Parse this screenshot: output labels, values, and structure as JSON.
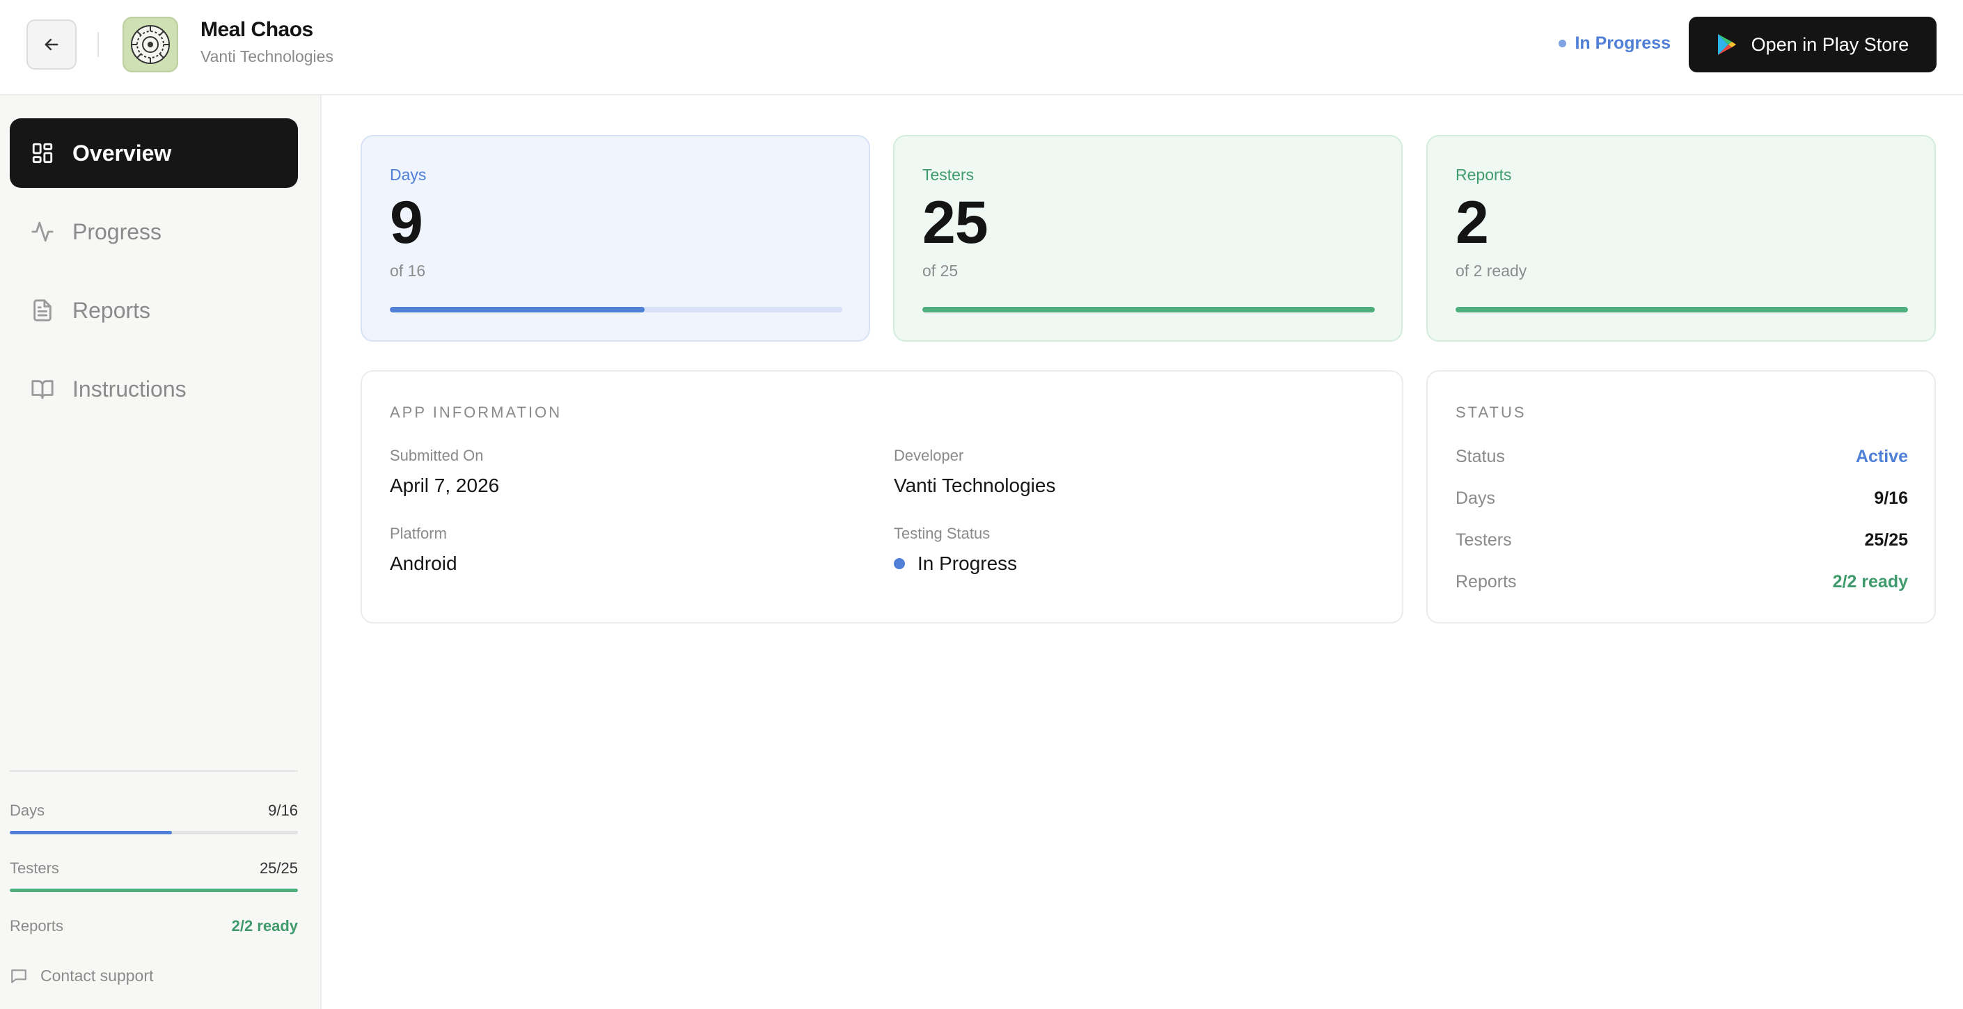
{
  "header": {
    "app_name": "Meal Chaos",
    "developer": "Vanti Technologies",
    "status": "In Progress",
    "play_button": "Open in Play Store"
  },
  "sidebar": {
    "nav": [
      {
        "label": "Overview",
        "icon": "grid-icon",
        "active": true
      },
      {
        "label": "Progress",
        "icon": "activity-icon",
        "active": false
      },
      {
        "label": "Reports",
        "icon": "document-icon",
        "active": false
      },
      {
        "label": "Instructions",
        "icon": "book-icon",
        "active": false
      }
    ],
    "summary": [
      {
        "label": "Days",
        "value": "9/16",
        "progress": 0.5625,
        "color": "#4f7fd6"
      },
      {
        "label": "Testers",
        "value": "25/25",
        "progress": 1.0,
        "color": "#4fae7d"
      },
      {
        "label": "Reports",
        "value": "2/2 ready"
      }
    ],
    "contact": "Contact support"
  },
  "stats": [
    {
      "label": "Days",
      "value": "9",
      "sub": "of 16",
      "progress": 0.5625,
      "color": "#4f7fd6",
      "track": "#d6e1f7",
      "label_color": "#4f7fd6"
    },
    {
      "label": "Testers",
      "value": "25",
      "sub": "of 25",
      "progress": 1.0,
      "color": "#4fae7d",
      "track": "#d3ecdd",
      "label_color": "#3f9a6c"
    },
    {
      "label": "Reports",
      "value": "2",
      "sub": "of 2 ready",
      "progress": 1.0,
      "color": "#4fae7d",
      "track": "#d3ecdd",
      "label_color": "#3f9a6c"
    }
  ],
  "app_info": {
    "title": "APP INFORMATION",
    "submitted_label": "Submitted On",
    "submitted_value": "April 7, 2026",
    "developer_label": "Developer",
    "developer_value": "Vanti Technologies",
    "platform_label": "Platform",
    "platform_value": "Android",
    "testing_label": "Testing Status",
    "testing_value": "In Progress"
  },
  "status_card": {
    "title": "STATUS",
    "rows": [
      {
        "label": "Status",
        "value": "Active",
        "color": "#4f7fd6"
      },
      {
        "label": "Days",
        "value": "9/16",
        "color": "#161616"
      },
      {
        "label": "Testers",
        "value": "25/25",
        "color": "#161616"
      },
      {
        "label": "Reports",
        "value": "2/2 ready",
        "color": "#3f9a6c"
      }
    ]
  }
}
